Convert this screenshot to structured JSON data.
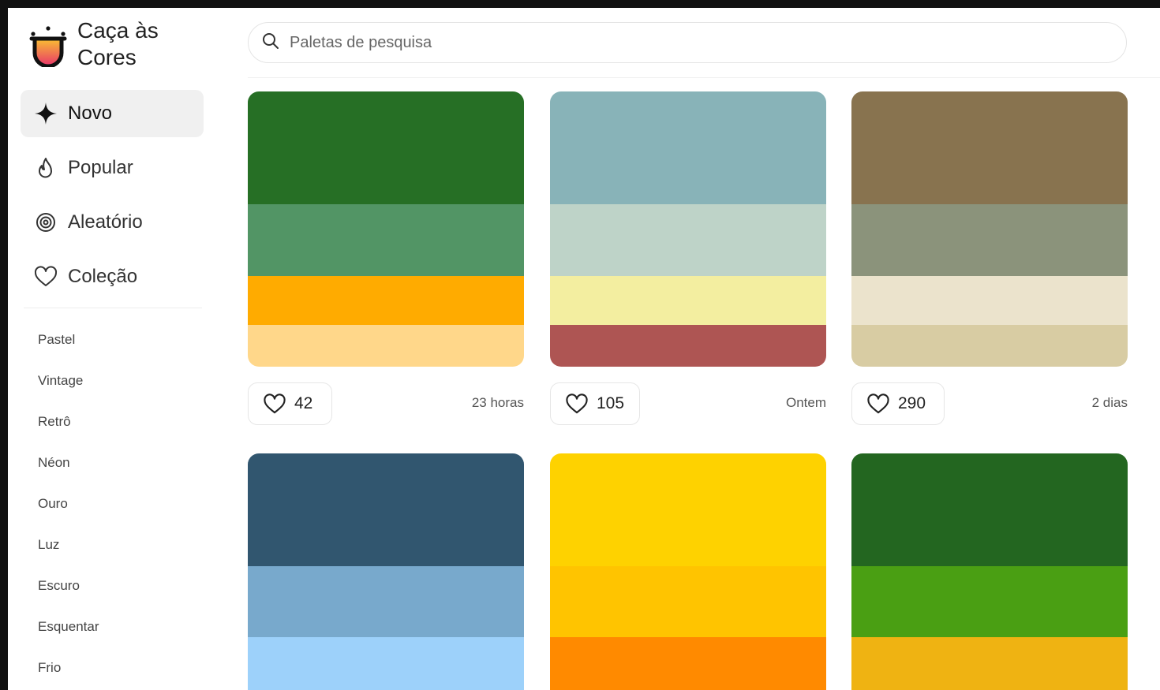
{
  "app": {
    "name_line1": "Caça às",
    "name_line2": "Cores"
  },
  "search": {
    "placeholder": "Paletas de pesquisa",
    "value": ""
  },
  "nav": [
    {
      "label": "Novo",
      "icon": "sparkle-icon",
      "active": true
    },
    {
      "label": "Popular",
      "icon": "flame-icon",
      "active": false
    },
    {
      "label": "Aleatório",
      "icon": "spiral-icon",
      "active": false
    },
    {
      "label": "Coleção",
      "icon": "heart-outline-icon",
      "active": false
    }
  ],
  "categories": [
    "Pastel",
    "Vintage",
    "Retrô",
    "Néon",
    "Ouro",
    "Luz",
    "Escuro",
    "Esquentar",
    "Frio"
  ],
  "palettes": [
    {
      "colors": [
        "#266F25",
        "#529565",
        "#FFAB00",
        "#FFD78A"
      ],
      "likes": "42",
      "time": "23 horas"
    },
    {
      "colors": [
        "#88B3B8",
        "#BED3C8",
        "#F3EEA0",
        "#AE5553"
      ],
      "likes": "105",
      "time": "Ontem"
    },
    {
      "colors": [
        "#88734F",
        "#8B937B",
        "#EBE3CC",
        "#D8CCA3"
      ],
      "likes": "290",
      "time": "2 dias"
    },
    {
      "colors": [
        "#31566F",
        "#78A9CC",
        "#9DD1FA"
      ],
      "likes": "",
      "time": ""
    },
    {
      "colors": [
        "#FED200",
        "#FFC400",
        "#FF8A00"
      ],
      "likes": "",
      "time": ""
    },
    {
      "colors": [
        "#236620",
        "#4A9F13",
        "#EFB312"
      ],
      "likes": "",
      "time": ""
    }
  ],
  "colors": {
    "logo_top": "#F9C132",
    "logo_bottom": "#E8336B",
    "active_bg": "#F0F0F0"
  }
}
